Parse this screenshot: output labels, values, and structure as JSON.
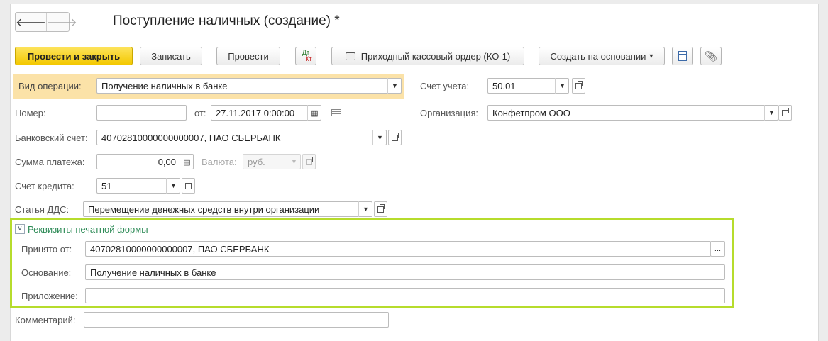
{
  "window": {
    "title": "Поступление наличных (создание) *"
  },
  "nav": {
    "back": "🡐",
    "forward": "🡒"
  },
  "toolbar": {
    "post_close": "Провести и закрыть",
    "save": "Записать",
    "post": "Провести",
    "dtkt_top": "Дт",
    "dtkt_bottom": "Кт",
    "print_order": "Приходный кассовый ордер (КО-1)",
    "create_based": "Создать на основании",
    "create_based_arrow": "▾"
  },
  "form": {
    "operation_type": {
      "label": "Вид операции:",
      "value": "Получение наличных в банке"
    },
    "account": {
      "label": "Счет учета:",
      "value": "50.01"
    },
    "number": {
      "label": "Номер:",
      "value": ""
    },
    "date": {
      "label": "от:",
      "value": "27.11.2017  0:00:00"
    },
    "organization": {
      "label": "Организация:",
      "value": "Конфетпром ООО"
    },
    "bank_account": {
      "label": "Банковский счет:",
      "value": "40702810000000000007, ПАО СБЕРБАНК"
    },
    "payment_sum": {
      "label": "Сумма платежа:",
      "value": "0,00"
    },
    "currency": {
      "label": "Валюта:",
      "value": "руб."
    },
    "credit_account": {
      "label": "Счет кредита:",
      "value": "51"
    },
    "dds_item": {
      "label": "Статья ДДС:",
      "value": "Перемещение денежных средств внутри организации"
    },
    "comment": {
      "label": "Комментарий:",
      "value": ""
    }
  },
  "print_group": {
    "title": "Реквизиты печатной формы",
    "received_from": {
      "label": "Принято от:",
      "value": "40702810000000000007, ПАО СБЕРБАНК",
      "button": "..."
    },
    "basis": {
      "label": "Основание:",
      "value": "Получение наличных в банке"
    },
    "attachment": {
      "label": "Приложение:",
      "value": ""
    }
  },
  "colors": {
    "primary_button": "#f3c800",
    "group_border": "#b6dc2c",
    "group_title": "#2e8b57",
    "highlight": "#fbe2a8"
  }
}
